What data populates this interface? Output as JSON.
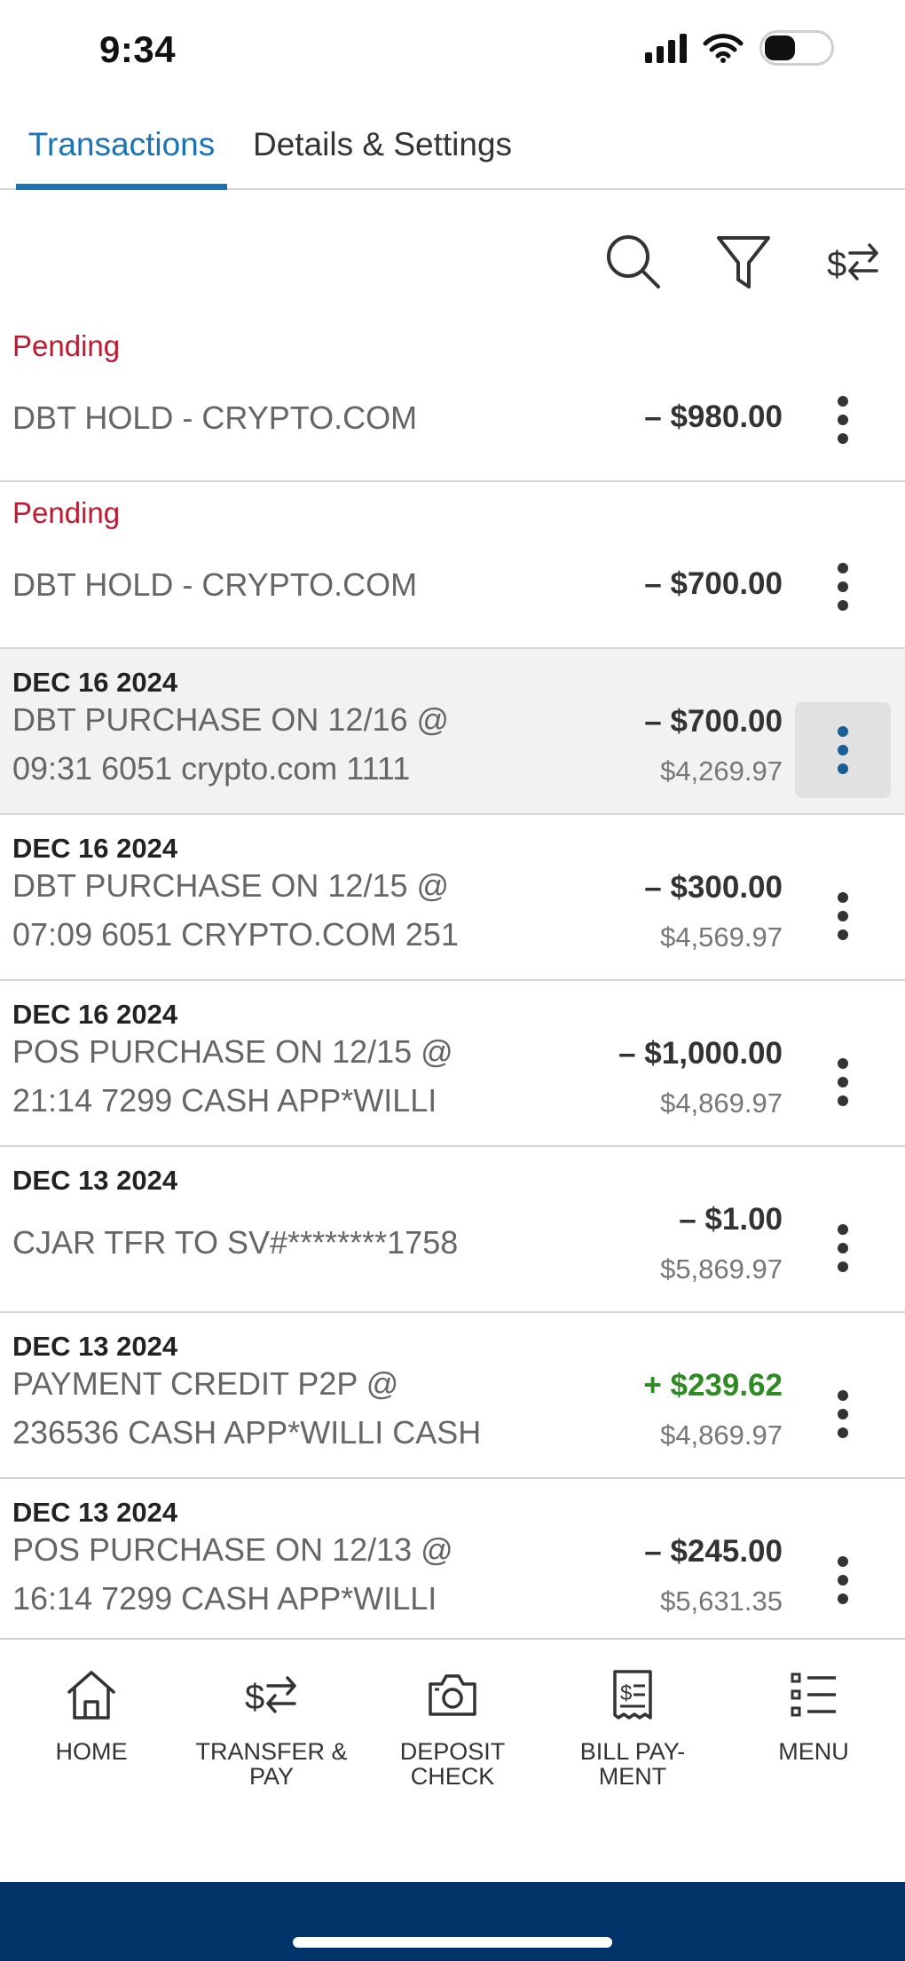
{
  "status_bar": {
    "time": "9:34"
  },
  "tabs": [
    {
      "label": "Transactions",
      "active": true
    },
    {
      "label": "Details & Settings",
      "active": false
    }
  ],
  "toolbar": {
    "icons": [
      "search-icon",
      "filter-icon",
      "transfer-sort-icon"
    ]
  },
  "transactions": [
    {
      "status": "Pending",
      "description": "DBT HOLD - CRYPTO.COM",
      "amount": "– $980.00"
    },
    {
      "status": "Pending",
      "description": "DBT HOLD - CRYPTO.COM",
      "amount": "– $700.00"
    },
    {
      "date": "DEC 16 2024",
      "description": "DBT PURCHASE ON 12/16 @ 09:31 6051 crypto.com 1111",
      "amount": "– $700.00",
      "balance": "$4,269.97",
      "highlighted": true
    },
    {
      "date": "DEC 16 2024",
      "description": "DBT PURCHASE ON 12/15 @ 07:09 6051 CRYPTO.COM 251",
      "amount": "– $300.00",
      "balance": "$4,569.97"
    },
    {
      "date": "DEC 16 2024",
      "description": "POS PURCHASE ON 12/15 @ 21:14 7299 CASH APP*WILLI",
      "amount": "– $1,000.00",
      "balance": "$4,869.97"
    },
    {
      "date": "DEC 13 2024",
      "description": "CJAR TFR TO SV#********1758",
      "amount": "– $1.00",
      "balance": "$5,869.97"
    },
    {
      "date": "DEC 13 2024",
      "description": "PAYMENT CREDIT P2P @ 236536 CASH APP*WILLI CASH",
      "amount": "+ $239.62",
      "balance": "$4,869.97",
      "credit": true
    },
    {
      "date": "DEC 13 2024",
      "description": "POS PURCHASE ON 12/13 @ 16:14 7299 CASH APP*WILLI",
      "amount": "– $245.00",
      "balance": "$5,631.35"
    }
  ],
  "bottom_nav": [
    {
      "label_line1": "HOME",
      "label_line2": "",
      "icon": "home-icon"
    },
    {
      "label_line1": "TRANSFER &",
      "label_line2": "PAY",
      "icon": "transfer-icon"
    },
    {
      "label_line1": "DEPOSIT",
      "label_line2": "CHECK",
      "icon": "camera-icon"
    },
    {
      "label_line1": "BILL PAY-",
      "label_line2": "MENT",
      "icon": "bill-icon"
    },
    {
      "label_line1": "MENU",
      "label_line2": "",
      "icon": "menu-list-icon"
    }
  ],
  "colors": {
    "accent": "#1a73b8",
    "pending": "#c0182e",
    "credit": "#2e8b24",
    "footer": "#003469"
  }
}
